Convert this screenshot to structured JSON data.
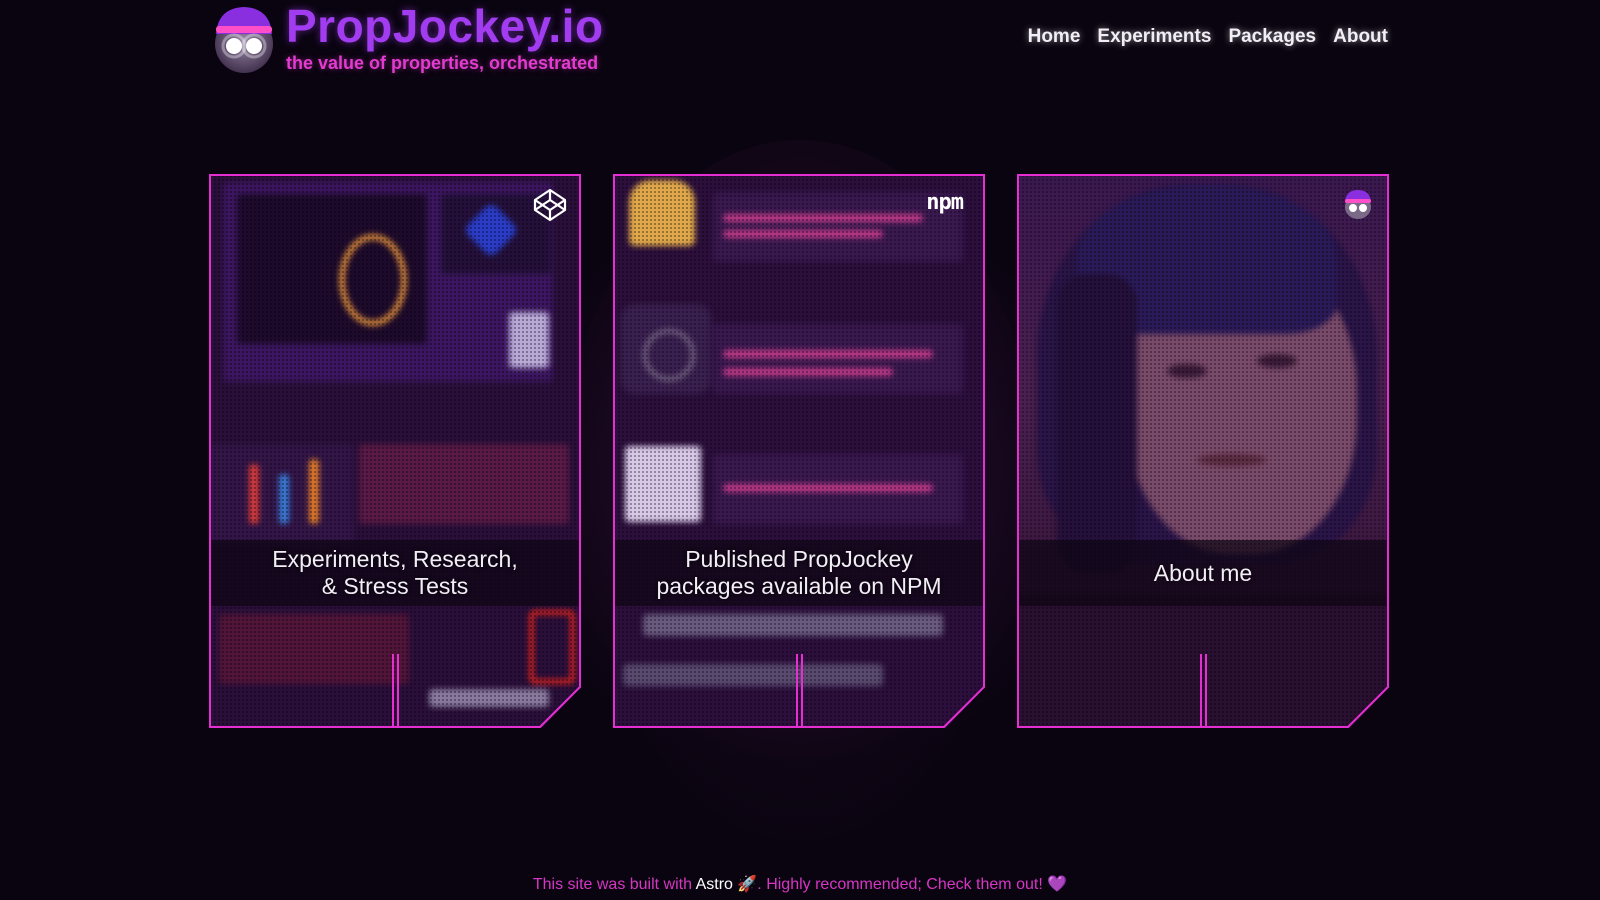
{
  "brand": {
    "title": "PropJockey.io",
    "tagline": "the value of properties, orchestrated"
  },
  "nav": {
    "items": [
      {
        "label": "Home"
      },
      {
        "label": "Experiments"
      },
      {
        "label": "Packages"
      },
      {
        "label": "About"
      }
    ]
  },
  "cards": [
    {
      "caption": "Experiments, Research,\n& Stress Tests",
      "icon": "codepen-icon"
    },
    {
      "caption": "Published PropJockey\npackages available on NPM",
      "icon": "npm-logo",
      "icon_text": "npm"
    },
    {
      "caption": "About me",
      "icon": "propjockey-mascot-icon"
    }
  ],
  "footer": {
    "prefix": "This site was built with",
    "link": "Astro",
    "rocket": "🚀",
    "suffix": ". Highly recommended; Check them out!",
    "heart": "💜"
  },
  "colors": {
    "background": "#0a0410",
    "accent_purple": "#a23cf0",
    "accent_pink": "#e33bd0",
    "frame": "#e62fd2"
  }
}
